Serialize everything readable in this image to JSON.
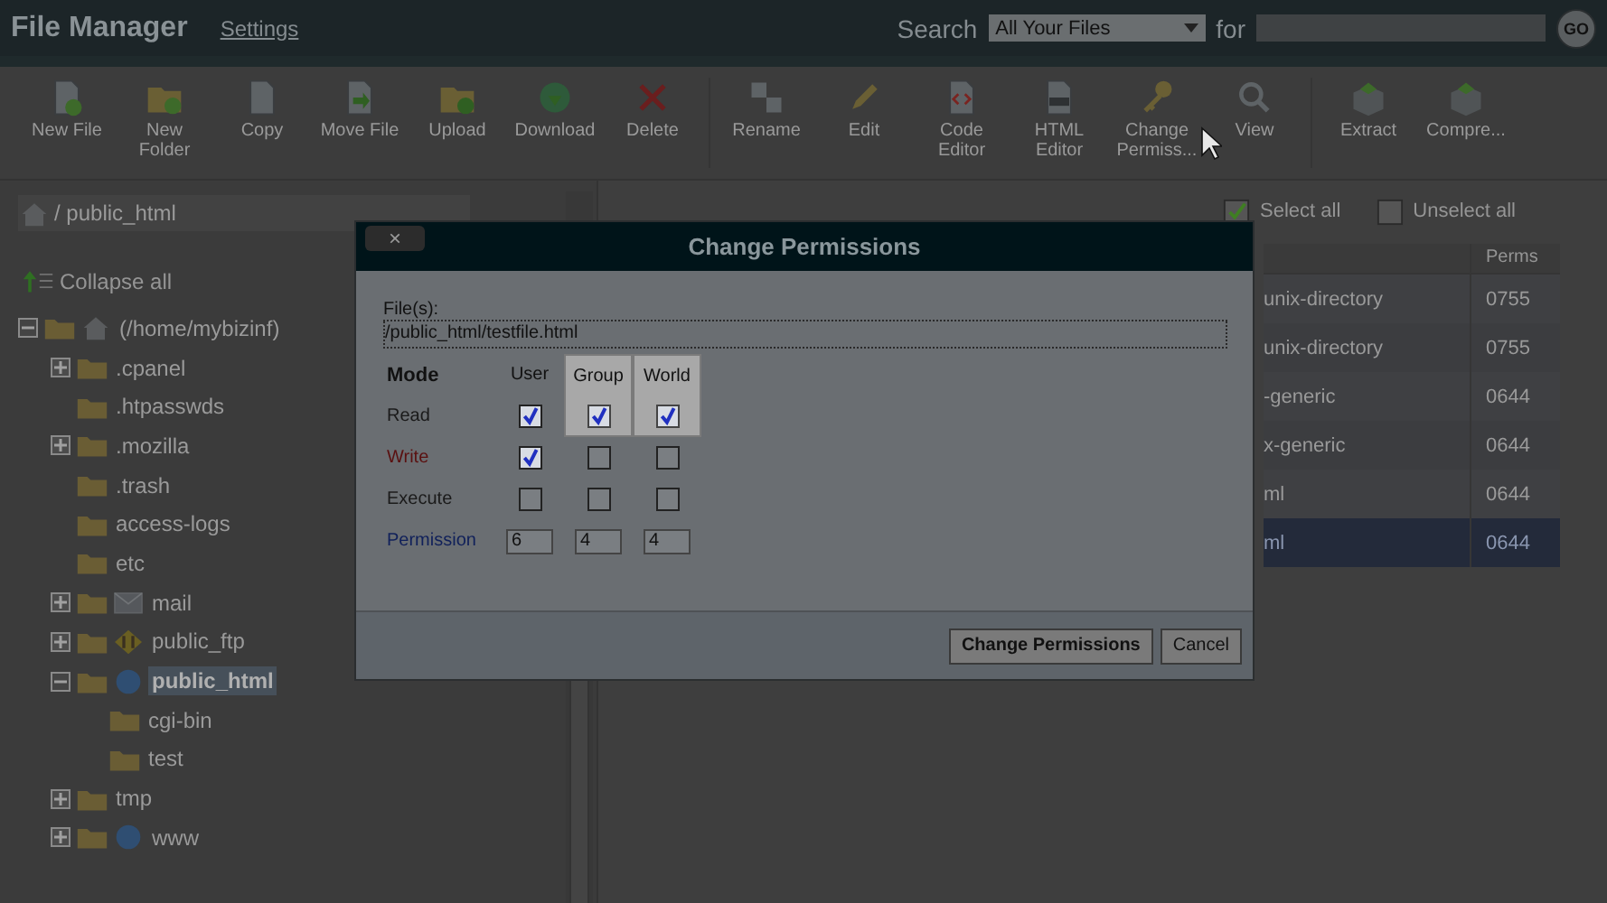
{
  "header": {
    "title": "File Manager",
    "settings_link": "Settings",
    "search_label": "Search",
    "search_scope": "All Your Files",
    "for_label": "for",
    "go_button": "GO"
  },
  "toolbar": {
    "groups": [
      [
        {
          "label": "New File"
        },
        {
          "label": "New Folder"
        },
        {
          "label": "Copy"
        },
        {
          "label": "Move File"
        },
        {
          "label": "Upload"
        },
        {
          "label": "Download"
        },
        {
          "label": "Delete"
        }
      ],
      [
        {
          "label": "Rename"
        },
        {
          "label": "Edit"
        },
        {
          "label": "Code Editor"
        },
        {
          "label": "HTML Editor"
        },
        {
          "label": "Change Permiss..."
        },
        {
          "label": "View"
        }
      ],
      [
        {
          "label": "Extract"
        },
        {
          "label": "Compre..."
        }
      ]
    ]
  },
  "sidebar": {
    "path": "/ public_html",
    "collapse_all": "Collapse all",
    "tree": [
      {
        "label": "(/home/mybizinf)",
        "kind": "home",
        "expandable": true,
        "expanded": true,
        "selected": false,
        "children": [
          {
            "label": ".cpanel",
            "kind": "folder",
            "expandable": true,
            "expanded": false,
            "selected": false
          },
          {
            "label": ".htpasswds",
            "kind": "folder",
            "expandable": false,
            "selected": false
          },
          {
            "label": ".mozilla",
            "kind": "folder",
            "expandable": true,
            "expanded": false,
            "selected": false
          },
          {
            "label": ".trash",
            "kind": "folder",
            "expandable": false,
            "selected": false
          },
          {
            "label": "access-logs",
            "kind": "folder",
            "expandable": false,
            "selected": false
          },
          {
            "label": "etc",
            "kind": "folder",
            "expandable": false,
            "selected": false
          },
          {
            "label": "mail",
            "kind": "mail",
            "expandable": true,
            "expanded": false,
            "selected": false
          },
          {
            "label": "public_ftp",
            "kind": "ftp",
            "expandable": true,
            "expanded": false,
            "selected": false
          },
          {
            "label": "public_html",
            "kind": "web",
            "expandable": true,
            "expanded": true,
            "selected": true,
            "children": [
              {
                "label": "cgi-bin",
                "kind": "folder",
                "expandable": false,
                "selected": false
              },
              {
                "label": "test",
                "kind": "folder",
                "expandable": false,
                "selected": false
              }
            ]
          },
          {
            "label": "tmp",
            "kind": "folder",
            "expandable": true,
            "expanded": false,
            "selected": false
          },
          {
            "label": "www",
            "kind": "web",
            "expandable": true,
            "expanded": false,
            "selected": false
          }
        ]
      }
    ]
  },
  "file_list": {
    "select_all": "Select all",
    "unselect_all": "Unselect all",
    "columns": [
      "Perms"
    ],
    "rows": [
      {
        "type": "unix-directory",
        "perms": "0755",
        "selected": false
      },
      {
        "type": "unix-directory",
        "perms": "0755",
        "selected": false
      },
      {
        "type": "-generic",
        "perms": "0644",
        "selected": false
      },
      {
        "type": "x-generic",
        "perms": "0644",
        "selected": false
      },
      {
        "type": "ml",
        "perms": "0644",
        "selected": false
      },
      {
        "type": "ml",
        "perms": "0644",
        "selected": true
      }
    ]
  },
  "dialog": {
    "title": "Change Permissions",
    "close": "×",
    "files_label": "File(s):",
    "files_value": "/public_html/testfile.html",
    "columns": [
      {
        "label": "Mode",
        "highlighted": false
      },
      {
        "label": "User",
        "highlighted": false
      },
      {
        "label": "Group",
        "highlighted": true
      },
      {
        "label": "World",
        "highlighted": true
      }
    ],
    "rows": [
      {
        "label": "Read",
        "color": "#1a1a1a",
        "checks": [
          true,
          true,
          true
        ]
      },
      {
        "label": "Write",
        "color": "#5a1010",
        "checks": [
          true,
          false,
          false
        ]
      },
      {
        "label": "Execute",
        "color": "#1a1a1a",
        "checks": [
          false,
          false,
          false
        ]
      }
    ],
    "permission": {
      "label": "Permission",
      "color": "#10205a",
      "values": [
        "6",
        "4",
        "4"
      ]
    },
    "buttons": [
      "Change Permissions",
      "Cancel"
    ]
  }
}
